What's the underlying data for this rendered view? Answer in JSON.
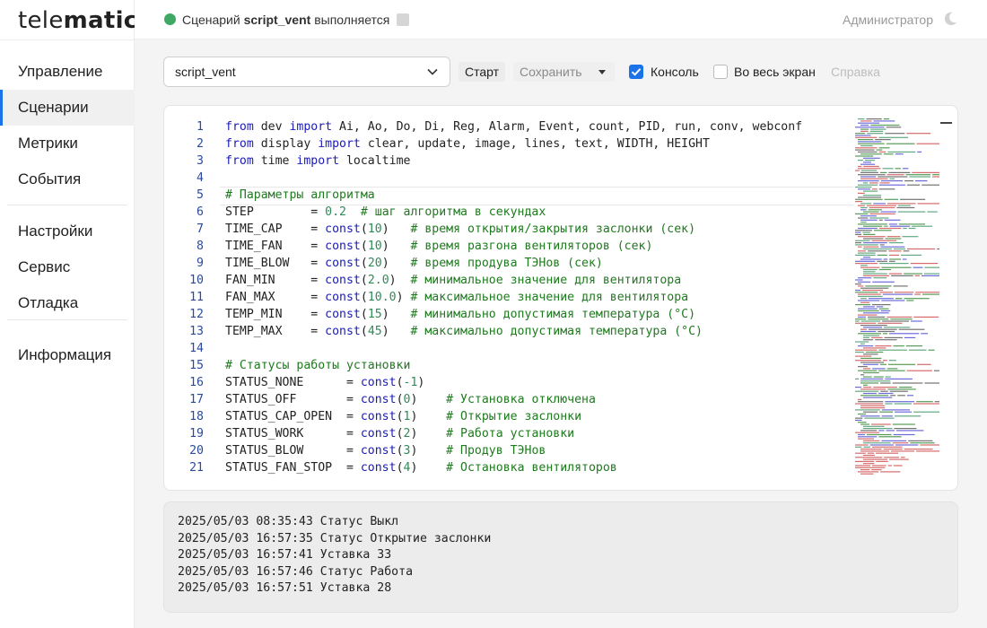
{
  "logo": {
    "part1": "tele",
    "part2": "matic"
  },
  "status": {
    "prefix": "Сценарий",
    "script": "script_vent",
    "suffix": "выполняется"
  },
  "user": "Администратор",
  "nav": {
    "group1": [
      "Управление",
      "Сценарии",
      "Метрики",
      "События"
    ],
    "group2": [
      "Настройки",
      "Сервис",
      "Отладка"
    ],
    "group3": [
      "Информация"
    ],
    "active": "Сценарии"
  },
  "toolbar": {
    "selected_script": "script_vent",
    "start_label": "Старт",
    "save_label": "Сохранить",
    "console_label": "Консоль",
    "console_checked": true,
    "fullscreen_label": "Во весь экран",
    "fullscreen_checked": false,
    "help_label": "Справка"
  },
  "code_lines": [
    [
      [
        "kw",
        "from"
      ],
      [
        "t",
        " dev "
      ],
      [
        "kw",
        "import"
      ],
      [
        "t",
        " Ai, Ao, Do, Di, Reg, Alarm, Event, count, PID, run, conv, webconf"
      ]
    ],
    [
      [
        "kw",
        "from"
      ],
      [
        "t",
        " display "
      ],
      [
        "kw",
        "import"
      ],
      [
        "t",
        " clear, update, image, lines, text, WIDTH, HEIGHT"
      ]
    ],
    [
      [
        "kw",
        "from"
      ],
      [
        "t",
        " time "
      ],
      [
        "kw",
        "import"
      ],
      [
        "t",
        " localtime"
      ]
    ],
    [],
    [
      [
        "cm",
        "# Параметры алгоритма"
      ]
    ],
    [
      [
        "t",
        "STEP        = "
      ],
      [
        "num",
        "0.2"
      ],
      [
        "t",
        "  "
      ],
      [
        "cm",
        "# шаг алгоритма в секундах"
      ]
    ],
    [
      [
        "t",
        "TIME_CAP    = "
      ],
      [
        "kw",
        "const"
      ],
      [
        "t",
        "("
      ],
      [
        "num",
        "10"
      ],
      [
        "t",
        ")   "
      ],
      [
        "cm",
        "# время открытия/закрытия заслонки (сек)"
      ]
    ],
    [
      [
        "t",
        "TIME_FAN    = "
      ],
      [
        "kw",
        "const"
      ],
      [
        "t",
        "("
      ],
      [
        "num",
        "10"
      ],
      [
        "t",
        ")   "
      ],
      [
        "cm",
        "# время разгона вентиляторов (сек)"
      ]
    ],
    [
      [
        "t",
        "TIME_BLOW   = "
      ],
      [
        "kw",
        "const"
      ],
      [
        "t",
        "("
      ],
      [
        "num",
        "20"
      ],
      [
        "t",
        ")   "
      ],
      [
        "cm",
        "# время продува ТЭНов (сек)"
      ]
    ],
    [
      [
        "t",
        "FAN_MIN     = "
      ],
      [
        "kw",
        "const"
      ],
      [
        "t",
        "("
      ],
      [
        "num",
        "2.0"
      ],
      [
        "t",
        ")  "
      ],
      [
        "cm",
        "# минимальное значение для вентилятора"
      ]
    ],
    [
      [
        "t",
        "FAN_MAX     = "
      ],
      [
        "kw",
        "const"
      ],
      [
        "t",
        "("
      ],
      [
        "num",
        "10.0"
      ],
      [
        "t",
        ") "
      ],
      [
        "cm",
        "# максимальное значение для вентилятора"
      ]
    ],
    [
      [
        "t",
        "TEMP_MIN    = "
      ],
      [
        "kw",
        "const"
      ],
      [
        "t",
        "("
      ],
      [
        "num",
        "15"
      ],
      [
        "t",
        ")   "
      ],
      [
        "cm",
        "# минимально допустимая температура (°C)"
      ]
    ],
    [
      [
        "t",
        "TEMP_MAX    = "
      ],
      [
        "kw",
        "const"
      ],
      [
        "t",
        "("
      ],
      [
        "num",
        "45"
      ],
      [
        "t",
        ")   "
      ],
      [
        "cm",
        "# максимально допустимая температура (°C)"
      ]
    ],
    [],
    [
      [
        "cm",
        "# Статусы работы установки"
      ]
    ],
    [
      [
        "t",
        "STATUS_NONE      = "
      ],
      [
        "kw",
        "const"
      ],
      [
        "t",
        "("
      ],
      [
        "num",
        "-1"
      ],
      [
        "t",
        ")"
      ]
    ],
    [
      [
        "t",
        "STATUS_OFF       = "
      ],
      [
        "kw",
        "const"
      ],
      [
        "t",
        "("
      ],
      [
        "num",
        "0"
      ],
      [
        "t",
        ")    "
      ],
      [
        "cm",
        "# Установка отключена"
      ]
    ],
    [
      [
        "t",
        "STATUS_CAP_OPEN  = "
      ],
      [
        "kw",
        "const"
      ],
      [
        "t",
        "("
      ],
      [
        "num",
        "1"
      ],
      [
        "t",
        ")    "
      ],
      [
        "cm",
        "# Открытие заслонки"
      ]
    ],
    [
      [
        "t",
        "STATUS_WORK      = "
      ],
      [
        "kw",
        "const"
      ],
      [
        "t",
        "("
      ],
      [
        "num",
        "2"
      ],
      [
        "t",
        ")    "
      ],
      [
        "cm",
        "# Работа установки"
      ]
    ],
    [
      [
        "t",
        "STATUS_BLOW      = "
      ],
      [
        "kw",
        "const"
      ],
      [
        "t",
        "("
      ],
      [
        "num",
        "3"
      ],
      [
        "t",
        ")    "
      ],
      [
        "cm",
        "# Продув ТЭНов"
      ]
    ],
    [
      [
        "t",
        "STATUS_FAN_STOP  = "
      ],
      [
        "kw",
        "const"
      ],
      [
        "t",
        "("
      ],
      [
        "num",
        "4"
      ],
      [
        "t",
        ")    "
      ],
      [
        "cm",
        "# Остановка вентиляторов"
      ]
    ]
  ],
  "console_lines": [
    "2025/05/03 08:35:43 Статус Выкл",
    "2025/05/03 16:57:35 Статус Открытие заслонки",
    "2025/05/03 16:57:41 Уставка 33",
    "2025/05/03 16:57:46 Статус Работа",
    "2025/05/03 16:57:51 Уставка 28"
  ],
  "colors": {
    "accent": "#1a73e8",
    "running": "#3fa865",
    "keyword": "#1a1ab8",
    "number": "#2e8b57",
    "comment": "#1f7a1f"
  },
  "icons": {
    "dropdown": "chevron-down-icon",
    "theme": "moon-icon",
    "stop": "stop-icon"
  }
}
